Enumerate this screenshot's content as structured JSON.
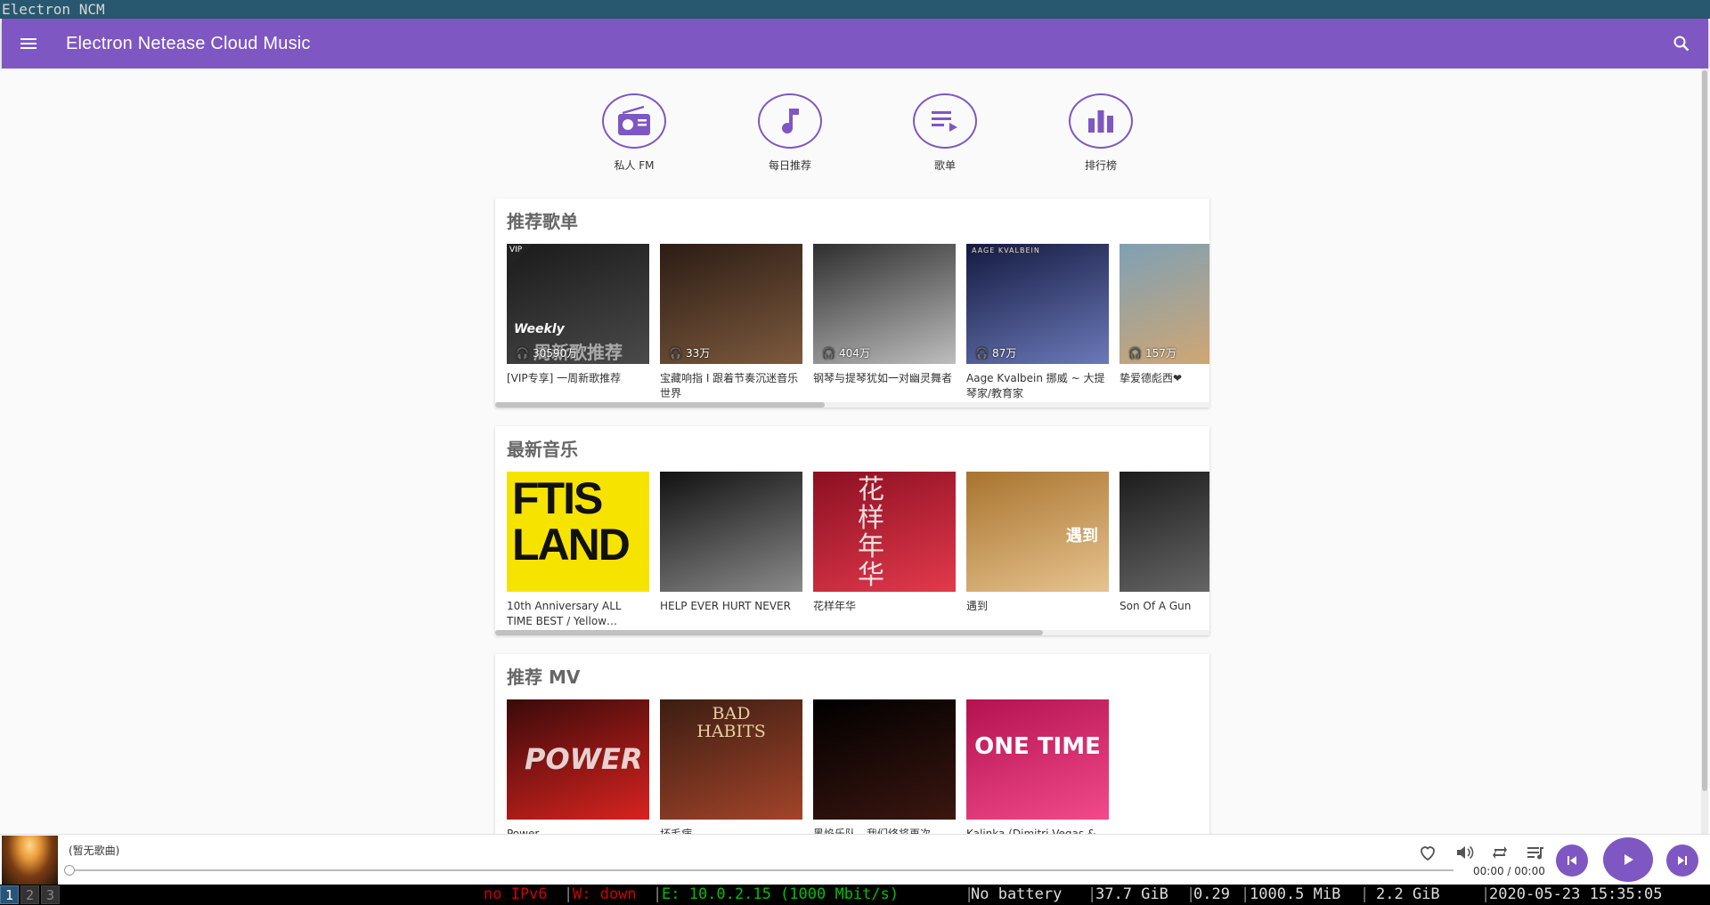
{
  "window": {
    "title": "Electron NCM"
  },
  "appbar": {
    "title": "Electron Netease Cloud Music",
    "menu_icon": "menu-icon",
    "search_icon": "search-icon"
  },
  "shortcuts": [
    {
      "label": "私人 FM",
      "icon": "radio-icon"
    },
    {
      "label": "每日推荐",
      "icon": "music-note-icon"
    },
    {
      "label": "歌单",
      "icon": "playlist-icon"
    },
    {
      "label": "排行榜",
      "icon": "chart-bars-icon"
    }
  ],
  "playlists": {
    "heading": "推荐歌单",
    "items": [
      {
        "name": "[VIP专享] 一周新歌推荐",
        "plays": "30590万",
        "vip_badge": "VIP",
        "cover_text": "Weekly",
        "cover_subtext": "周新歌推荐",
        "colors": [
          "#1a1a1a",
          "#4a4a4a"
        ]
      },
      {
        "name": "宝藏响指 I 跟着节奏沉迷音乐世界",
        "plays": "33万",
        "colors": [
          "#2b1c14",
          "#7d5a3e"
        ]
      },
      {
        "name": "钢琴与提琴犹如一对幽灵舞者",
        "plays": "404万",
        "colors": [
          "#2e2e2e",
          "#bdbdbd"
        ]
      },
      {
        "name": "Aage Kvalbein 挪威 ~ 大提琴家/教育家",
        "plays": "87万",
        "cover_text": "AAGE KVALBEIN",
        "colors": [
          "#141a40",
          "#6b79b8"
        ]
      },
      {
        "name": "挚爱德彪西❤",
        "plays": "157万",
        "colors": [
          "#7fa0b5",
          "#d9a76a"
        ]
      }
    ]
  },
  "new_music": {
    "heading": "最新音乐",
    "items": [
      {
        "name": "10th Anniversary ALL TIME BEST / Yellow…",
        "cover_text": "FTIS LAND",
        "colors": [
          "#f7e300",
          "#f7e300"
        ]
      },
      {
        "name": "HELP EVER HURT NEVER",
        "colors": [
          "#111111",
          "#8a8a8a"
        ]
      },
      {
        "name": "花样年华",
        "cover_text": "花样年华",
        "colors": [
          "#8c0f22",
          "#e23a4c"
        ]
      },
      {
        "name": "遇到",
        "cover_text": "遇到",
        "colors": [
          "#a8742e",
          "#e7c38f"
        ]
      },
      {
        "name": "Son Of A Gun",
        "colors": [
          "#1c1c1c",
          "#6e6e6e"
        ]
      }
    ]
  },
  "mv": {
    "heading": "推荐 MV",
    "items": [
      {
        "name": "Power",
        "cover_text": "POWER",
        "colors": [
          "#3a0a0a",
          "#d8231f"
        ]
      },
      {
        "name": "坏毛病",
        "cover_text": "BAD HABITS",
        "colors": [
          "#3c1d12",
          "#a3442a"
        ]
      },
      {
        "name": "黑焰乐队 - 我们终将再次",
        "colors": [
          "#000000",
          "#3b1610"
        ]
      },
      {
        "name": "Kalinka (Dimitri Vegas &",
        "cover_text": "ONE TIME",
        "colors": [
          "#b3124f",
          "#f24a8c"
        ]
      }
    ]
  },
  "player": {
    "song": "(暂无歌曲)",
    "time": "00:00 / 00:00",
    "progress": 0
  },
  "statusbar": {
    "workspaces": [
      "1",
      "2",
      "3"
    ],
    "ipv6": "no IPv6",
    "wifi": "W: down",
    "ethernet": "E: 10.0.2.15 (1000 Mbit/s)",
    "battery": "No battery",
    "disk": "37.7 GiB",
    "load": "0.29",
    "mem_free": "1000.5 MiB",
    "mem_used": "2.2 GiB",
    "datetime": "2020-05-23 15:35:05"
  },
  "accent_color": "#7e57c2"
}
